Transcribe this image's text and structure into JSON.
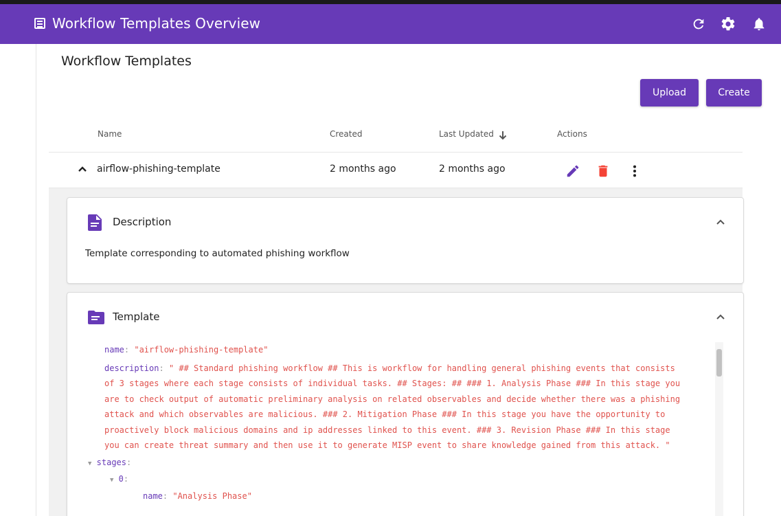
{
  "header": {
    "title": "Workflow Templates Overview",
    "icons": [
      "refresh-icon",
      "settings-icon",
      "notifications-icon"
    ],
    "color": "#673ab7"
  },
  "page": {
    "title": "Workflow Templates",
    "upload_label": "Upload",
    "create_label": "Create"
  },
  "table": {
    "columns": [
      "Name",
      "Created",
      "Last Updated",
      "Actions"
    ],
    "rows": [
      {
        "name": "airflow-phishing-template",
        "created": "2 months ago",
        "updated": "2 months ago"
      }
    ]
  },
  "description": {
    "heading": "Description",
    "text": "Template corresponding to automated phishing workflow"
  },
  "template": {
    "heading": "Template",
    "name_key": "name",
    "name_value": "\"airflow-phishing-template\"",
    "desc_key": "description",
    "desc_lines": [
      "\" ## Standard phishing workflow ## This is workflow for handling general phishing events that consists",
      "of 3 stages where each stage consists of individual tasks. ## Stages: ## ### 1. Analysis Phase ### In this stage you",
      "are to check output of automatic preliminary analysis on related observables and decide whether there was a phishing",
      "attack and which observables are malicious. ### 2. Mitigation Phase ### In this stage you have the opportunity to",
      "proactively block malicious domains and ip addresses linked to this event. ### 3. Revision Phase ### In this stage",
      "you can create threat summary and then use it to generate MISP event to share knowledge gained from this attack. \""
    ],
    "stages_key": "stages",
    "stage_index": "0",
    "stage_name_key": "name",
    "stage_name_value": "\"Analysis Phase\""
  }
}
